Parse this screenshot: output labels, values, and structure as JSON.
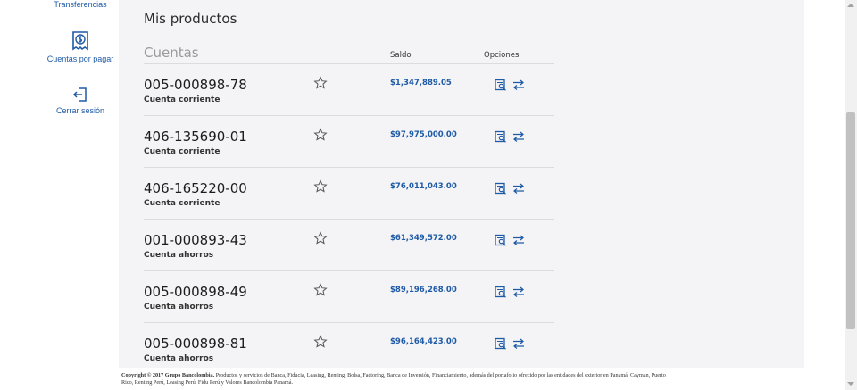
{
  "sidebar": {
    "items": [
      {
        "label": "Transferencias",
        "icon": "transfer-icon"
      },
      {
        "label": "Cuentas por pagar",
        "icon": "receipt-dollar-icon"
      },
      {
        "label": "Cerrar sesión",
        "icon": "logout-icon"
      }
    ]
  },
  "main": {
    "title": "Mis productos",
    "table": {
      "section_title": "Cuentas",
      "col_saldo": "Saldo",
      "col_opciones": "Opciones",
      "rows": [
        {
          "number": "005-000898-78",
          "type": "Cuenta corriente",
          "balance": "$1,347,889.05"
        },
        {
          "number": "406-135690-01",
          "type": "Cuenta corriente",
          "balance": "$97,975,000.00"
        },
        {
          "number": "406-165220-00",
          "type": "Cuenta corriente",
          "balance": "$76,011,043.00"
        },
        {
          "number": "001-000893-43",
          "type": "Cuenta ahorros",
          "balance": "$61,349,572.00"
        },
        {
          "number": "005-000898-49",
          "type": "Cuenta ahorros",
          "balance": "$89,196,268.00"
        },
        {
          "number": "005-000898-81",
          "type": "Cuenta ahorros",
          "balance": "$96,164,423.00"
        }
      ]
    }
  },
  "footer": {
    "copyright": "Copyright © 2017 Grupo Bancolombia.",
    "text": " Productos y servicios de Banca, Fiducia, Leasing, Renting, Bolsa, Factoring, Banca de Inversión, Financiamiento, además del portafolio ofrecido por las entidades del exterior en Panamá, Cayman, Puerto Rico, Renting Perú, Leasing Perú, Fidu Perú y Valores Bancolombia Panamá."
  },
  "colors": {
    "accent": "#1f5aa6",
    "panel": "#f4f4f6"
  }
}
